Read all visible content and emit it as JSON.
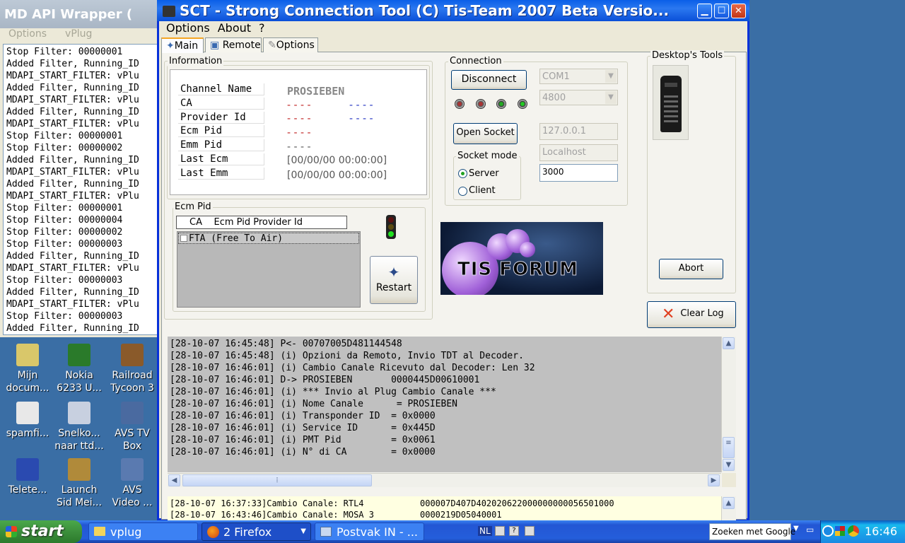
{
  "bg_window": {
    "title": "MD API Wrapper (",
    "menu": [
      "Options",
      "vPlug"
    ],
    "log": [
      "Stop Filter: 00000001",
      "Added Filter, Running_ID",
      "MDAPI_START_FILTER: vPlu",
      "Added Filter, Running_ID",
      "MDAPI_START_FILTER: vPlu",
      "Added Filter, Running_ID",
      "MDAPI_START_FILTER: vPlu",
      "Stop Filter: 00000001",
      "Stop Filter: 00000002",
      "Added Filter, Running_ID",
      "MDAPI_START_FILTER: vPlu",
      "Added Filter, Running_ID",
      "MDAPI_START_FILTER: vPlu",
      "Stop Filter: 00000001",
      "Stop Filter: 00000004",
      "Stop Filter: 00000002",
      "Stop Filter: 00000003",
      "Added Filter, Running_ID",
      "MDAPI_START_FILTER: vPlu",
      "Stop Filter: 00000003",
      "Added Filter, Running_ID",
      "MDAPI_START_FILTER: vPlu",
      "Stop Filter: 00000003",
      "Added Filter, Running_ID"
    ]
  },
  "desktop_icons": [
    {
      "label1": "Mijn",
      "label2": "docum...",
      "icon": "document-icon",
      "color": "#d9c76a"
    },
    {
      "label1": "Nokia",
      "label2": "6233 U...",
      "icon": "phone-icon",
      "color": "#2a7a2a"
    },
    {
      "label1": "Railroad",
      "label2": "Tycoon 3",
      "icon": "game-icon",
      "color": "#8a5a2a"
    },
    {
      "label1": "spamfi...",
      "label2": "",
      "icon": "disc-icon",
      "color": "#e8e8e8"
    },
    {
      "label1": "Snelko...",
      "label2": "naar ttd...",
      "icon": "shortcut-icon",
      "color": "#c8d0e0"
    },
    {
      "label1": "AVS TV",
      "label2": "Box",
      "icon": "tv-icon",
      "color": "#4a6aa0"
    },
    {
      "label1": "Telete...",
      "label2": "",
      "icon": "teletext-icon",
      "color": "#2a4ab0"
    },
    {
      "label1": "Launch",
      "label2": "Sid Mei...",
      "icon": "civ-icon",
      "color": "#b08a3a"
    },
    {
      "label1": "AVS",
      "label2": "Video ...",
      "icon": "video-icon",
      "color": "#5a7ab0"
    }
  ],
  "main": {
    "title": "SCT - Strong Connection Tool     (C) Tis-Team 2007     Beta  Versio...",
    "menu": [
      "Options",
      "About",
      "?"
    ],
    "tabs": [
      "Main",
      "Remote",
      "Options"
    ],
    "info": {
      "legend": "Information",
      "labels": [
        "Channel Name",
        "CA",
        "Provider Id",
        "Ecm Pid",
        "Emm Pid",
        "Last Ecm",
        "Last Emm"
      ],
      "channel_name": "PROSIEBEN",
      "ca1": "- - - -",
      "ca2": "- - - -",
      "prov1": "- - - -",
      "prov2": "- - - -",
      "ecm_pid": "- - - -",
      "emm_pid": "- - - -",
      "last_ecm": "[00/00/00 00:00:00]",
      "last_emm": "[00/00/00 00:00:00]"
    },
    "ecm": {
      "legend": "Ecm Pid",
      "headers": [
        "CA",
        "Ecm Pid",
        "Provider Id"
      ],
      "item": "FTA (Free To Air)",
      "restart": "Restart"
    },
    "connection": {
      "legend": "Connection",
      "disconnect": "Disconnect",
      "port": "COM1",
      "baud": "4800",
      "open_socket": "Open Socket",
      "ip": "127.0.0.1",
      "host": "Localhost",
      "socket_mode": "Socket mode",
      "server": "Server",
      "client": "Client",
      "socket_port": "3000"
    },
    "banner": "TIS FORUM",
    "desk_tools": {
      "legend": "Desktop's Tools",
      "abort": "Abort"
    },
    "clear_log": "Clear Log",
    "log": [
      "[28-10-07 16:45:48] P<- 00707005D481144548",
      "[28-10-07 16:45:48] (i) Opzioni da Remoto, Invio TDT al Decoder.",
      "[28-10-07 16:46:01] (i) Cambio Canale Ricevuto dal Decoder: Len 32",
      "[28-10-07 16:46:01] D-> PROSIEBEN       0000445D00610001",
      "[28-10-07 16:46:01] (i) *** Invio al Plug Cambio Canale ***",
      "[28-10-07 16:46:01] (i) Nome Canale      = PROSIEBEN",
      "[28-10-07 16:46:01] (i) Transponder ID  = 0x0000",
      "[28-10-07 16:46:01] (i) Service ID      = 0x445D",
      "[28-10-07 16:46:01] (i) PMT Pid         = 0x0061",
      "[28-10-07 16:46:01] (i) N° di CA        = 0x0000"
    ],
    "log2": [
      "[28-10-07 16:37:33]Cambio Canale: RTL4           000007D407D402020622000000000056501000",
      "[28-10-07 16:43:46]Cambio Canale: MOSA 3         0000219D05040001"
    ]
  },
  "taskbar": {
    "start": "start",
    "items": [
      "vplug",
      "2 Firefox",
      "Postvak IN - ..."
    ],
    "lang": "NL",
    "search": "Zoeken met Google",
    "clock": "16:46"
  }
}
